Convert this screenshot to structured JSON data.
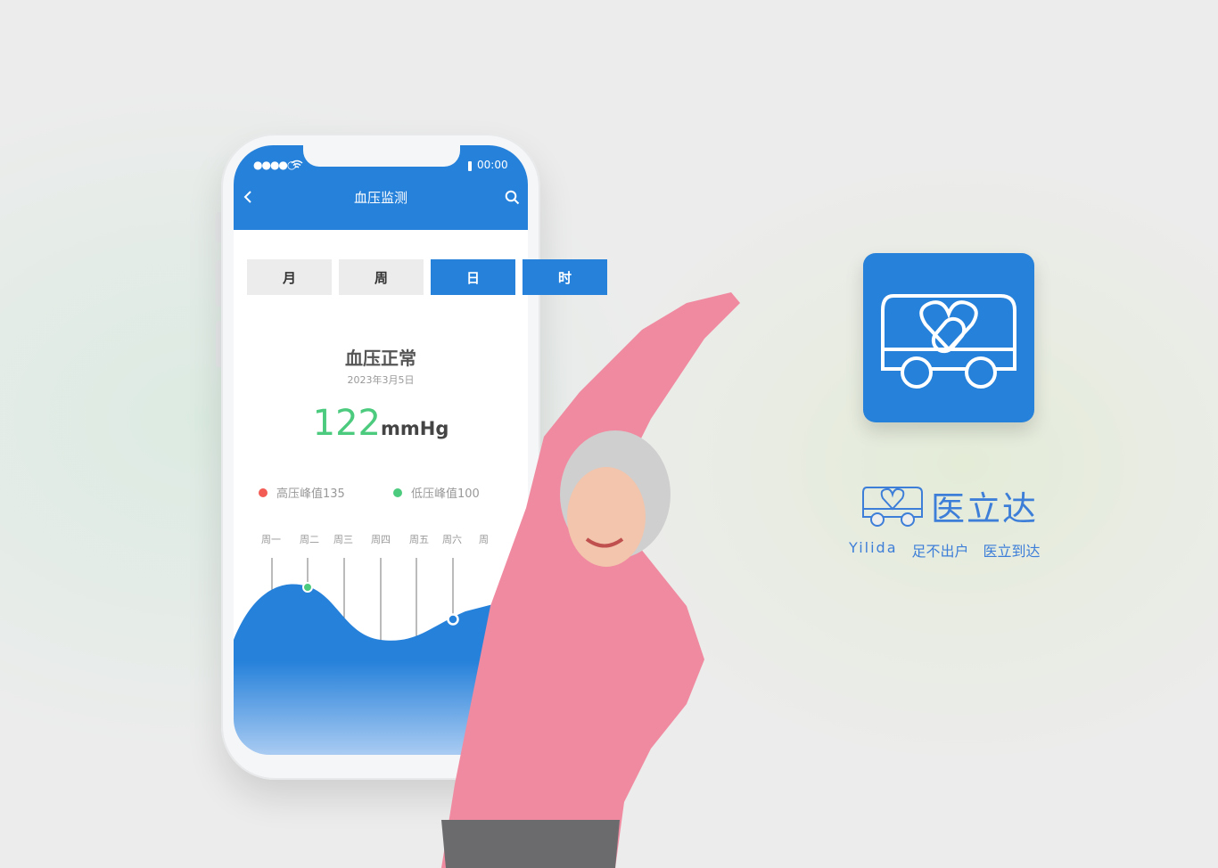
{
  "status_bar": {
    "signal": "●●●●○",
    "time": "00:00"
  },
  "header": {
    "title": "血压监测"
  },
  "tabs": [
    {
      "label": "月"
    },
    {
      "label": "周"
    },
    {
      "label": "日",
      "active": true
    },
    {
      "label": "时",
      "active": true
    }
  ],
  "summary": {
    "status": "血压正常",
    "date": "2023年3月5日",
    "value": "122",
    "unit": "mmHg"
  },
  "legend": [
    {
      "label": "高压峰值135",
      "color": "#f25c54"
    },
    {
      "label": "低压峰值100",
      "color": "#4ccb7f"
    }
  ],
  "weekdays": [
    "周一",
    "周二",
    "周三",
    "周四",
    "周五",
    "周六",
    "周"
  ],
  "brand": {
    "name": "医立达",
    "latin": "Yilida",
    "slogan1": "足不出户",
    "slogan2": "医立到达",
    "color": "#2681da"
  }
}
